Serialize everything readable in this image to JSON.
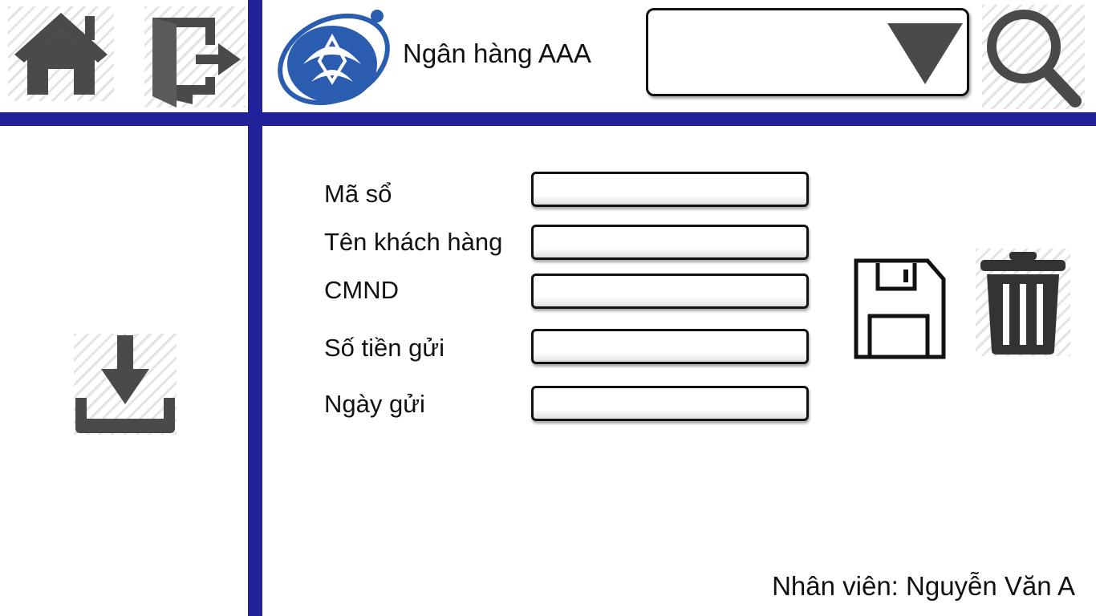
{
  "colors": {
    "accent_bar": "#21219a",
    "icon_gray": "#4a4a4a",
    "logo_blue": "#2a5db0"
  },
  "header": {
    "bank_name": "Ngân hàng AAA",
    "dropdown": {
      "selected": ""
    },
    "icons": [
      "home-icon",
      "logout-icon",
      "bank-logo",
      "chevron-down-icon",
      "search-icon"
    ]
  },
  "sidebar": {
    "icons": [
      "download-icon"
    ]
  },
  "form": {
    "fields": [
      {
        "label": "Mã sổ",
        "value": ""
      },
      {
        "label": "Tên khách hàng",
        "value": ""
      },
      {
        "label": "CMND",
        "value": ""
      },
      {
        "label": "Số tiền gửi",
        "value": ""
      },
      {
        "label": "Ngày gửi",
        "value": ""
      }
    ],
    "actions": [
      "save-icon",
      "delete-icon"
    ]
  },
  "footer": {
    "staff": "Nhân viên: Nguyễn Văn A"
  }
}
